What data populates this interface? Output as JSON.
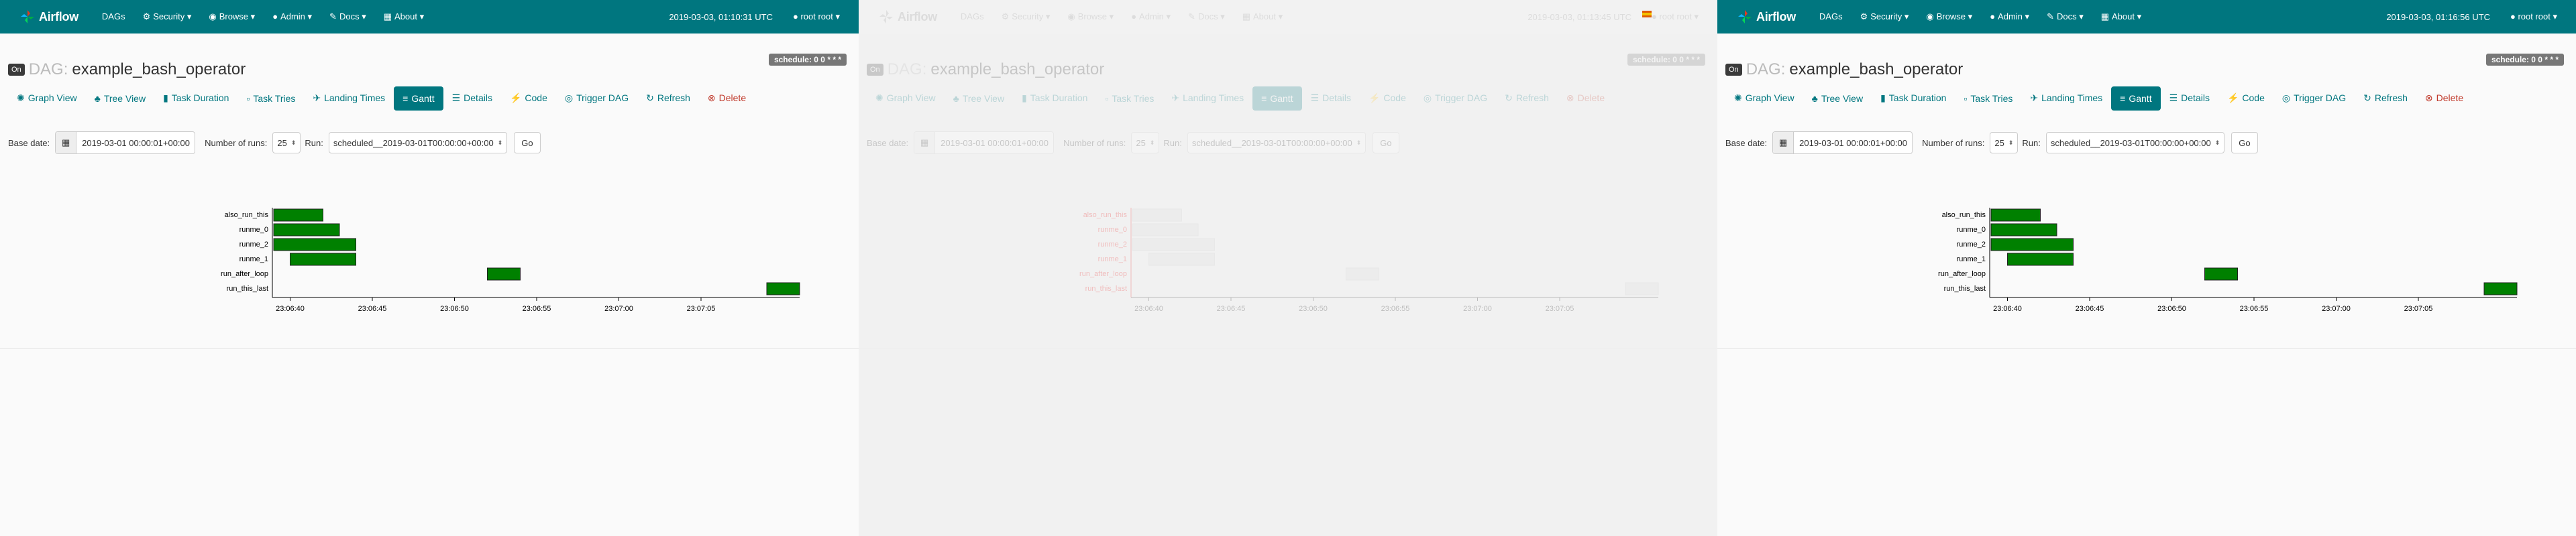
{
  "app": {
    "brand": "Airflow",
    "user": "root root",
    "menu": [
      "DAGs",
      "Security",
      "Browse",
      "Admin",
      "Docs",
      "About"
    ]
  },
  "panels": [
    {
      "clock": "2019-03-03, 01:10:31 UTC"
    },
    {
      "clock": "2019-03-03, 01:13:45 UTC"
    },
    {
      "clock": "2019-03-03, 01:16:56 UTC"
    }
  ],
  "dag": {
    "on_label": "On",
    "label": "DAG:",
    "name": "example_bash_operator",
    "schedule": "schedule: 0 0 * * *"
  },
  "tabs": [
    "Graph View",
    "Tree View",
    "Task Duration",
    "Task Tries",
    "Landing Times",
    "Gantt",
    "Details",
    "Code",
    "Trigger DAG",
    "Refresh",
    "Delete"
  ],
  "active_tab": "Gantt",
  "form": {
    "base_date_label": "Base date:",
    "base_date_value": "2019-03-01 00:00:01+00:00",
    "num_runs_label": "Number of runs:",
    "num_runs_value": "25",
    "run_label": "Run:",
    "run_value": "scheduled__2019-03-01T00:00:00+00:00",
    "go_label": "Go"
  },
  "colors": {
    "nav": "#00767f",
    "success": "#008000",
    "delete": "#c0392b"
  },
  "chart_data": {
    "type": "gantt",
    "tasks": [
      "also_run_this",
      "runme_0",
      "runme_2",
      "runme_1",
      "run_after_loop",
      "run_this_last"
    ],
    "bars": [
      {
        "task": "also_run_this",
        "start": "23:06:39",
        "end": "23:06:42",
        "state": "success"
      },
      {
        "task": "runme_0",
        "start": "23:06:39",
        "end": "23:06:43",
        "state": "success"
      },
      {
        "task": "runme_2",
        "start": "23:06:39",
        "end": "23:06:44",
        "state": "success"
      },
      {
        "task": "runme_1",
        "start": "23:06:40",
        "end": "23:06:44",
        "state": "success"
      },
      {
        "task": "run_after_loop",
        "start": "23:06:52",
        "end": "23:06:54",
        "state": "success"
      },
      {
        "task": "run_this_last",
        "start": "23:07:09",
        "end": "23:07:11",
        "state": "success"
      }
    ],
    "x_ticks": [
      "23:06:40",
      "23:06:45",
      "23:06:50",
      "23:06:55",
      "23:07:00",
      "23:07:05"
    ],
    "x_range": [
      "23:06:39",
      "23:07:11"
    ]
  }
}
